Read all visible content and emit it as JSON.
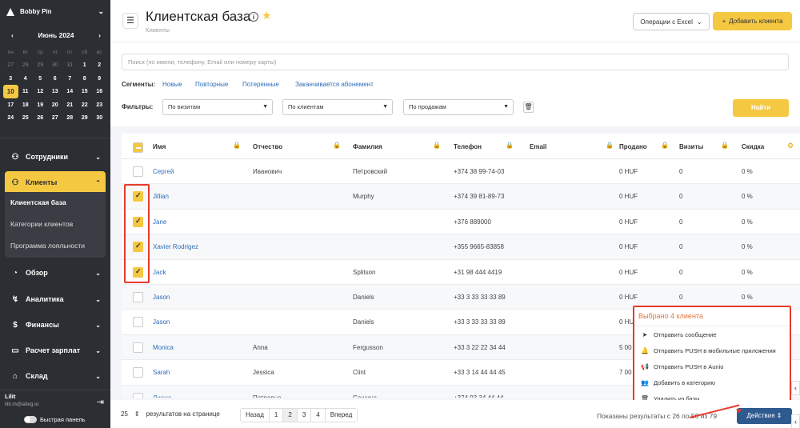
{
  "sidebar": {
    "company": "Bobby Pin",
    "calendar": {
      "month_label": "Июнь 2024",
      "prev": "‹",
      "next": "›",
      "weekdays": [
        "пн",
        "вт",
        "ср",
        "чт",
        "пт",
        "сб",
        "вс"
      ],
      "weeks": [
        [
          "27",
          "28",
          "29",
          "30",
          "31",
          "1",
          "2"
        ],
        [
          "3",
          "4",
          "5",
          "6",
          "7",
          "8",
          "9"
        ],
        [
          "10",
          "11",
          "12",
          "13",
          "14",
          "15",
          "16"
        ],
        [
          "17",
          "18",
          "19",
          "20",
          "21",
          "22",
          "23"
        ],
        [
          "24",
          "25",
          "26",
          "27",
          "28",
          "29",
          "30"
        ]
      ],
      "today": "10"
    },
    "nav": [
      {
        "label": "Сотрудники",
        "icon": "staff-icon"
      },
      {
        "label": "Клиенты",
        "icon": "clients-icon"
      },
      {
        "label": "Обзор",
        "icon": "overview-icon"
      },
      {
        "label": "Аналитика",
        "icon": "analytics-icon"
      },
      {
        "label": "Финансы",
        "icon": "finance-icon"
      },
      {
        "label": "Расчет зарплат",
        "icon": "payroll-icon"
      },
      {
        "label": "Склад",
        "icon": "warehouse-icon"
      }
    ],
    "subnav": [
      "Клиентская база",
      "Категории клиентов",
      "Программа лояльности"
    ],
    "user": {
      "name": "Lilit",
      "email": "lilit.m@alteg.io"
    },
    "quick_panel": "Быстрая панель"
  },
  "header": {
    "title": "Клиентская база",
    "breadcrumb": "Клиенты",
    "excel_button": "Операции с Excel",
    "add_button": "Добавить клиента"
  },
  "filters": {
    "search_placeholder": "Поиск (по имени, телефону, Email или номеру карты)",
    "segments_label": "Сегменты:",
    "segments": [
      "Новые",
      "Повторные",
      "Потерянные",
      "Заканчивается абонемент"
    ],
    "filters_label": "Фильтры:",
    "dropdowns": [
      "По визитам",
      "По клиентам",
      "По продажам"
    ],
    "find_button": "Найти"
  },
  "table": {
    "columns": [
      "Имя",
      "Отчество",
      "Фамилия",
      "Телефон",
      "Email",
      "Продано",
      "Визиты",
      "Скидка"
    ],
    "rows": [
      {
        "checked": false,
        "name": "Сергей",
        "middle": "Иванович",
        "last": "Петровский",
        "phone": "+374 38 99-74-03",
        "email": "",
        "sold": "0 HUF",
        "visits": "0",
        "discount": "0 %"
      },
      {
        "checked": true,
        "name": "Jillian",
        "middle": "",
        "last": "Murphy",
        "phone": "+374 39 81-89-73",
        "email": "",
        "sold": "0 HUF",
        "visits": "0",
        "discount": "0 %"
      },
      {
        "checked": true,
        "name": "Jane",
        "middle": "",
        "last": "",
        "phone": "+376 889000",
        "email": "",
        "sold": "0 HUF",
        "visits": "0",
        "discount": "0 %"
      },
      {
        "checked": true,
        "name": "Xavier Rodrigez",
        "middle": "",
        "last": "",
        "phone": "+355 9665-83858",
        "email": "",
        "sold": "0 HUF",
        "visits": "0",
        "discount": "0 %"
      },
      {
        "checked": true,
        "name": "Jack",
        "middle": "",
        "last": "Splitson",
        "phone": "+31 98 444 4419",
        "email": "",
        "sold": "0 HUF",
        "visits": "0",
        "discount": "0 %"
      },
      {
        "checked": false,
        "name": "Jason",
        "middle": "",
        "last": "Daniels",
        "phone": "+33 3 33 33 33 89",
        "email": "",
        "sold": "0 HUF",
        "visits": "0",
        "discount": "0 %"
      },
      {
        "checked": false,
        "name": "Jason",
        "middle": "",
        "last": "Daniels",
        "phone": "+33 3 33 33 33 89",
        "email": "",
        "sold": "0 HU",
        "visits": "",
        "discount": ""
      },
      {
        "checked": false,
        "name": "Monica",
        "middle": "Anna",
        "last": "Fergusson",
        "phone": "+33 3 22 22 34 44",
        "email": "",
        "sold": "5 00",
        "visits": "",
        "discount": ""
      },
      {
        "checked": false,
        "name": "Sarah",
        "middle": "Jessica",
        "last": "Clint",
        "phone": "+33 3 14 44 44 45",
        "email": "",
        "sold": "7 00",
        "visits": "",
        "discount": ""
      },
      {
        "checked": false,
        "name": "Диана",
        "middle": "Петровна",
        "last": "Сашина",
        "phone": "+374 93 34 44 44",
        "email": "",
        "sold": "",
        "visits": "",
        "discount": ""
      }
    ]
  },
  "actions_popup": {
    "title": "Выбрано 4 клиента",
    "items": [
      {
        "label": "Отправить сообщение",
        "icon": "send-icon"
      },
      {
        "label": "Отправить PUSH в мобильные приложения",
        "icon": "bell-icon"
      },
      {
        "label": "Отправить PUSH в Aunio",
        "icon": "megaphone-icon"
      },
      {
        "label": "Добавить в категорию",
        "icon": "users-icon"
      },
      {
        "label": "Удалить из базы",
        "icon": "trash-icon"
      }
    ]
  },
  "footer": {
    "per_page": "25",
    "per_page_label": "результатов на странице",
    "pagination": [
      "Назад",
      "1",
      "2",
      "3",
      "4",
      "Вперед"
    ],
    "current_page": "2",
    "shown_text": "Показаны результаты с 26 по 50 из 79",
    "actions_button": "Действия"
  },
  "colors": {
    "accent": "#f5c842",
    "sidebar": "#2b2e33",
    "link": "#2e6db8",
    "highlight": "#e53b2c",
    "primary_button": "#2e5a8f"
  }
}
